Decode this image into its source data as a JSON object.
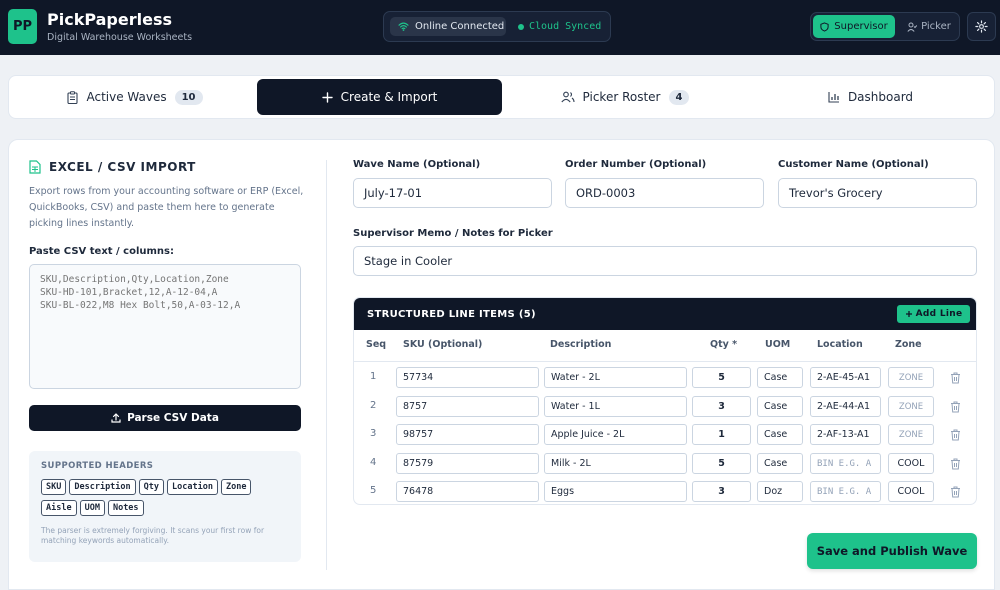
{
  "app": {
    "logo": "PP",
    "title": "PickPaperless",
    "subtitle": "Digital Warehouse Worksheets"
  },
  "status": {
    "online": "Online Connected",
    "synced": "Cloud Synced"
  },
  "roles": {
    "supervisor": "Supervisor",
    "picker": "Picker"
  },
  "tabs": [
    {
      "label": "Active Waves",
      "badge": "10",
      "icon": "clipboard-icon"
    },
    {
      "label": "Create & Import",
      "icon": "plus-icon"
    },
    {
      "label": "Picker Roster",
      "badge": "4",
      "icon": "users-icon"
    },
    {
      "label": "Dashboard",
      "icon": "bar-chart-icon"
    }
  ],
  "import": {
    "title": "EXCEL / CSV IMPORT",
    "description": "Export rows from your accounting software or ERP (Excel, QuickBooks, CSV) and paste them here to generate picking lines instantly.",
    "csv_label": "Paste CSV text / columns:",
    "csv_placeholder": "SKU,Description,Qty,Location,Zone\nSKU-HD-101,Bracket,12,A-12-04,A\nSKU-BL-022,M8 Hex Bolt,50,A-03-12,A",
    "parse_button": "Parse CSV Data",
    "supported_title": "SUPPORTED HEADERS",
    "supported_headers": [
      "SKU",
      "Description",
      "Qty",
      "Location",
      "Zone",
      "Aisle",
      "UOM",
      "Notes"
    ],
    "note": "The parser is extremely forgiving. It scans your first row for matching keywords automatically."
  },
  "form": {
    "wave_label": "Wave Name (Optional)",
    "wave_value": "July-17-01",
    "order_label": "Order Number (Optional)",
    "order_value": "ORD-0003",
    "customer_label": "Customer Name (Optional)",
    "customer_value": "Trevor's Grocery",
    "memo_label": "Supervisor Memo / Notes for Picker",
    "memo_value": "Stage in Cooler"
  },
  "table": {
    "title": "STRUCTURED LINE ITEMS (5)",
    "add_button": "Add Line",
    "columns": {
      "seq": "Seq",
      "sku": "SKU (Optional)",
      "desc": "Description",
      "qty": "Qty *",
      "uom": "UOM",
      "loc": "Location",
      "zone": "Zone"
    },
    "location_placeholder": "BIN E.G. A",
    "zone_placeholder": "ZONE",
    "rows": [
      {
        "seq": "1",
        "sku": "57734",
        "desc": "Water - 2L",
        "qty": "5",
        "uom": "Case",
        "loc": "2-AE-45-A1",
        "zone": ""
      },
      {
        "seq": "2",
        "sku": "8757",
        "desc": "Water - 1L",
        "qty": "3",
        "uom": "Case",
        "loc": "2-AE-44-A1",
        "zone": ""
      },
      {
        "seq": "3",
        "sku": "98757",
        "desc": "Apple Juice - 2L",
        "qty": "1",
        "uom": "Case",
        "loc": "2-AF-13-A1",
        "zone": ""
      },
      {
        "seq": "4",
        "sku": "87579",
        "desc": "Milk - 2L",
        "qty": "5",
        "uom": "Case",
        "loc": "",
        "zone": "COOL"
      },
      {
        "seq": "5",
        "sku": "76478",
        "desc": "Eggs",
        "qty": "3",
        "uom": "Doz",
        "loc": "",
        "zone": "COOL"
      }
    ]
  },
  "save_button": "Save and Publish Wave",
  "colors": {
    "accent": "#1ec28b",
    "dark": "#0f1727"
  }
}
